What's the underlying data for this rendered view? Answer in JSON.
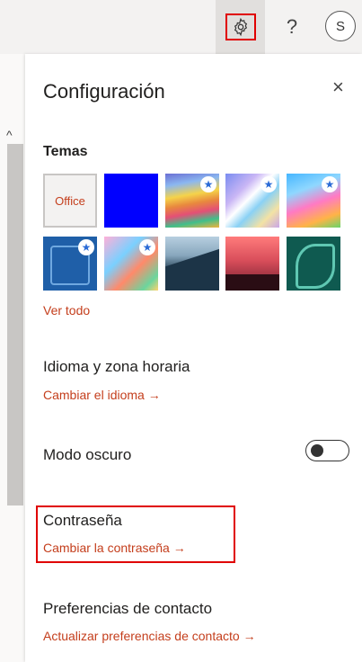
{
  "topbar": {
    "help_label": "?",
    "avatar_initial": "S",
    "settings_icon": "gear-icon"
  },
  "panel": {
    "title": "Configuración",
    "close_label": "×",
    "themes": {
      "title": "Temas",
      "office_label": "Office",
      "see_all": "Ver todo"
    },
    "language": {
      "title": "Idioma y zona horaria",
      "link": "Cambiar el idioma →"
    },
    "dark_mode": {
      "title": "Modo oscuro",
      "enabled": false
    },
    "password": {
      "title": "Contraseña",
      "link": "Cambiar la contraseña →"
    },
    "contact": {
      "title": "Preferencias de contacto",
      "link": "Actualizar preferencias de contacto →"
    }
  },
  "colors": {
    "accent": "#c43e1c",
    "highlight": "#e00000"
  }
}
